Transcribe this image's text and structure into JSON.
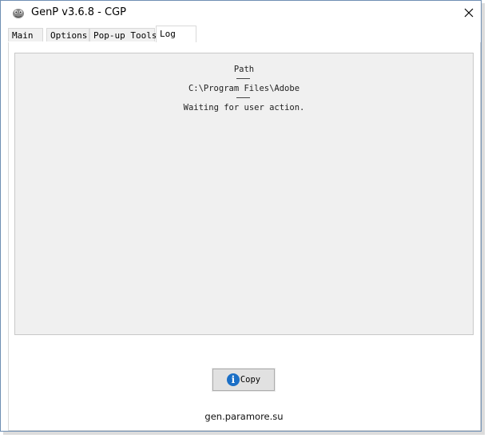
{
  "window": {
    "title": "GenP v3.6.8 - CGP",
    "close_icon": "close-icon",
    "app_icon": "app-icon"
  },
  "tabs": [
    {
      "label": "Main",
      "active": false
    },
    {
      "label": "Options",
      "active": false
    },
    {
      "label": "Pop-up Tools",
      "active": false
    },
    {
      "label": "Log",
      "active": true
    }
  ],
  "log": {
    "heading": "Path",
    "path": "C:\\Program Files\\Adobe",
    "status": "Waiting for user action."
  },
  "copy_button": {
    "label": "Copy",
    "icon": "info-icon"
  },
  "footer": {
    "link": "gen.paramore.su"
  },
  "colors": {
    "border": "#6f8fb3",
    "log_background": "#f0f0f0",
    "button_background": "#e1e1e1",
    "info_icon": "#1b6fc6"
  }
}
